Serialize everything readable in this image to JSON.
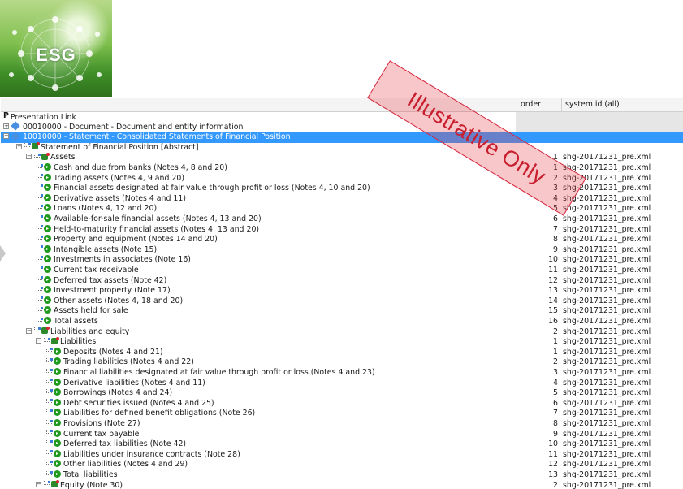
{
  "logo": {
    "text": "ESG"
  },
  "watermark": {
    "text": "Illustrative Only",
    "color": "#d7263d"
  },
  "columns": {
    "order": "order",
    "system_id": "system id (all)"
  },
  "colors": {
    "selection": "#3399ff",
    "item_icon": "#1f9a1f",
    "header_bg": "#f4f4f4"
  },
  "rows": [
    {
      "label": "Presentation Link",
      "indent": 0,
      "icon": "presentation-icon",
      "expander": "",
      "order": "",
      "sys": "",
      "style": "root"
    },
    {
      "label": "00010000 - Document - Document and entity information",
      "indent": 0,
      "icon": "link-role-icon",
      "expander": "+",
      "order": "",
      "sys": "",
      "style": "gray"
    },
    {
      "label": "10010000 - Statement - Consolidated Statements of Financial Position",
      "indent": 0,
      "icon": "link-role-icon",
      "expander": "−",
      "order": "",
      "sys": "",
      "style": "sel"
    },
    {
      "label": "Statement of Financial Position [Abstract]",
      "indent": 1,
      "icon": "abstract-icon",
      "expander": "−",
      "order": "",
      "sys": "",
      "style": ""
    },
    {
      "label": "Assets",
      "indent": 2,
      "icon": "abstract-icon",
      "expander": "−",
      "order": "1",
      "sys": "shg-20171231_pre.xml",
      "style": ""
    },
    {
      "label": "Cash and due from banks (Notes 4, 8 and 20)",
      "indent": 3,
      "icon": "element-icon",
      "expander": "",
      "order": "1",
      "sys": "shg-20171231_pre.xml",
      "style": ""
    },
    {
      "label": "Trading assets (Notes 4, 9 and 20)",
      "indent": 3,
      "icon": "element-icon",
      "expander": "",
      "order": "2",
      "sys": "shg-20171231_pre.xml",
      "style": ""
    },
    {
      "label": "Financial assets designated at fair value through profit or loss (Notes 4, 10 and 20)",
      "indent": 3,
      "icon": "element-icon",
      "expander": "",
      "order": "3",
      "sys": "shg-20171231_pre.xml",
      "style": ""
    },
    {
      "label": "Derivative assets (Notes 4 and 11)",
      "indent": 3,
      "icon": "element-icon",
      "expander": "",
      "order": "4",
      "sys": "shg-20171231_pre.xml",
      "style": ""
    },
    {
      "label": "Loans (Notes 4, 12 and 20)",
      "indent": 3,
      "icon": "element-icon",
      "expander": "",
      "order": "5",
      "sys": "shg-20171231_pre.xml",
      "style": ""
    },
    {
      "label": "Available-for-sale financial assets (Notes 4, 13 and 20)",
      "indent": 3,
      "icon": "element-icon",
      "expander": "",
      "order": "6",
      "sys": "shg-20171231_pre.xml",
      "style": ""
    },
    {
      "label": "Held-to-maturity financial assets (Notes 4, 13 and 20)",
      "indent": 3,
      "icon": "element-icon",
      "expander": "",
      "order": "7",
      "sys": "shg-20171231_pre.xml",
      "style": ""
    },
    {
      "label": "Property and equipment (Notes 14 and 20)",
      "indent": 3,
      "icon": "element-icon",
      "expander": "",
      "order": "8",
      "sys": "shg-20171231_pre.xml",
      "style": ""
    },
    {
      "label": "Intangible assets (Note 15)",
      "indent": 3,
      "icon": "element-icon",
      "expander": "",
      "order": "9",
      "sys": "shg-20171231_pre.xml",
      "style": ""
    },
    {
      "label": "Investments in associates (Note 16)",
      "indent": 3,
      "icon": "element-icon",
      "expander": "",
      "order": "10",
      "sys": "shg-20171231_pre.xml",
      "style": ""
    },
    {
      "label": "Current tax receivable",
      "indent": 3,
      "icon": "element-icon",
      "expander": "",
      "order": "11",
      "sys": "shg-20171231_pre.xml",
      "style": ""
    },
    {
      "label": "Deferred tax assets (Note 42)",
      "indent": 3,
      "icon": "element-icon",
      "expander": "",
      "order": "12",
      "sys": "shg-20171231_pre.xml",
      "style": ""
    },
    {
      "label": "Investment property (Note 17)",
      "indent": 3,
      "icon": "element-icon",
      "expander": "",
      "order": "13",
      "sys": "shg-20171231_pre.xml",
      "style": ""
    },
    {
      "label": "Other assets (Notes 4, 18 and 20)",
      "indent": 3,
      "icon": "element-icon",
      "expander": "",
      "order": "14",
      "sys": "shg-20171231_pre.xml",
      "style": ""
    },
    {
      "label": "Assets held for sale",
      "indent": 3,
      "icon": "element-icon",
      "expander": "",
      "order": "15",
      "sys": "shg-20171231_pre.xml",
      "style": ""
    },
    {
      "label": "Total assets",
      "indent": 3,
      "icon": "element-icon",
      "expander": "",
      "order": "16",
      "sys": "shg-20171231_pre.xml",
      "style": ""
    },
    {
      "label": "Liabilities and equity",
      "indent": 2,
      "icon": "abstract-icon",
      "expander": "−",
      "order": "2",
      "sys": "shg-20171231_pre.xml",
      "style": ""
    },
    {
      "label": "Liabilities",
      "indent": 3,
      "icon": "abstract-icon",
      "expander": "−",
      "order": "1",
      "sys": "shg-20171231_pre.xml",
      "style": ""
    },
    {
      "label": "Deposits (Notes 4 and 21)",
      "indent": 4,
      "icon": "element-icon",
      "expander": "",
      "order": "1",
      "sys": "shg-20171231_pre.xml",
      "style": ""
    },
    {
      "label": "Trading liabilities (Notes 4 and 22)",
      "indent": 4,
      "icon": "element-icon",
      "expander": "",
      "order": "2",
      "sys": "shg-20171231_pre.xml",
      "style": ""
    },
    {
      "label": "Financial liabilities designated at fair value through profit or loss (Notes 4 and 23)",
      "indent": 4,
      "icon": "element-icon",
      "expander": "",
      "order": "3",
      "sys": "shg-20171231_pre.xml",
      "style": ""
    },
    {
      "label": "Derivative liabilities (Notes 4 and 11)",
      "indent": 4,
      "icon": "element-icon",
      "expander": "",
      "order": "4",
      "sys": "shg-20171231_pre.xml",
      "style": ""
    },
    {
      "label": "Borrowings (Notes 4 and 24)",
      "indent": 4,
      "icon": "element-icon",
      "expander": "",
      "order": "5",
      "sys": "shg-20171231_pre.xml",
      "style": ""
    },
    {
      "label": "Debt securities issued (Notes 4 and 25)",
      "indent": 4,
      "icon": "element-icon",
      "expander": "",
      "order": "6",
      "sys": "shg-20171231_pre.xml",
      "style": ""
    },
    {
      "label": "Liabilities for defined benefit obligations (Note 26)",
      "indent": 4,
      "icon": "element-icon",
      "expander": "",
      "order": "7",
      "sys": "shg-20171231_pre.xml",
      "style": ""
    },
    {
      "label": "Provisions (Note 27)",
      "indent": 4,
      "icon": "element-icon",
      "expander": "",
      "order": "8",
      "sys": "shg-20171231_pre.xml",
      "style": ""
    },
    {
      "label": "Current tax payable",
      "indent": 4,
      "icon": "element-icon",
      "expander": "",
      "order": "9",
      "sys": "shg-20171231_pre.xml",
      "style": ""
    },
    {
      "label": "Deferred tax liabilities (Note 42)",
      "indent": 4,
      "icon": "element-icon",
      "expander": "",
      "order": "10",
      "sys": "shg-20171231_pre.xml",
      "style": ""
    },
    {
      "label": "Liabilities under insurance contracts (Note 28)",
      "indent": 4,
      "icon": "element-icon",
      "expander": "",
      "order": "11",
      "sys": "shg-20171231_pre.xml",
      "style": ""
    },
    {
      "label": "Other liabilities (Notes 4 and 29)",
      "indent": 4,
      "icon": "element-icon",
      "expander": "",
      "order": "12",
      "sys": "shg-20171231_pre.xml",
      "style": ""
    },
    {
      "label": "Total liabilities",
      "indent": 4,
      "icon": "element-icon",
      "expander": "",
      "order": "13",
      "sys": "shg-20171231_pre.xml",
      "style": ""
    },
    {
      "label": "Equity (Note 30)",
      "indent": 3,
      "icon": "abstract-icon",
      "expander": "−",
      "order": "2",
      "sys": "shg-20171231_pre.xml",
      "style": ""
    }
  ]
}
